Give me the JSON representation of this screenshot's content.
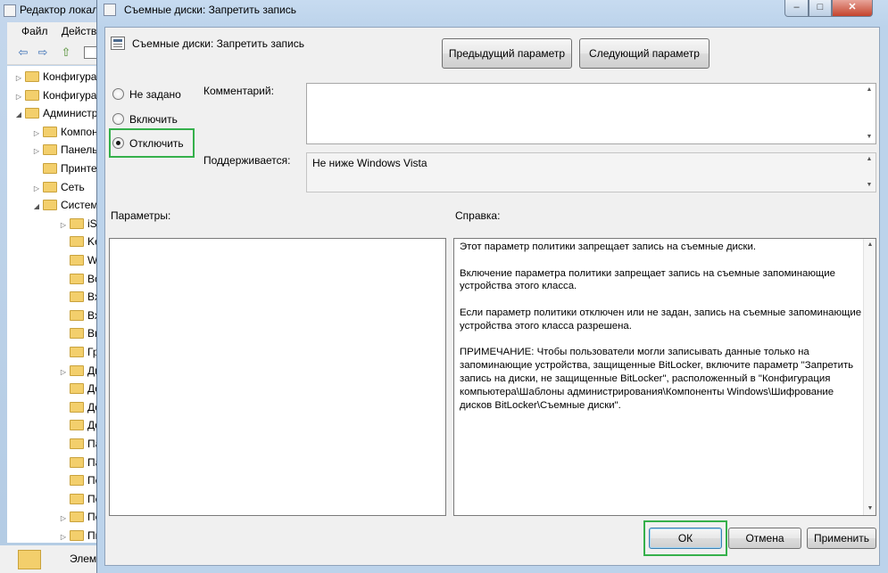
{
  "background_window": {
    "title": "Редактор локальной групповой политики",
    "menu": [
      "Файл",
      "Действие"
    ],
    "tree": [
      {
        "label": "Конфигурация компьютера",
        "indent": 0,
        "arrow": "▷"
      },
      {
        "label": "Конфигурация пользователя",
        "indent": 0,
        "arrow": "▷"
      },
      {
        "label": "Административные шаблоны",
        "indent": 0,
        "arrow": "◢"
      },
      {
        "label": "Компоненты Windows",
        "indent": 1,
        "arrow": "▷"
      },
      {
        "label": "Панель управления",
        "indent": 1,
        "arrow": "▷"
      },
      {
        "label": "Принтеры",
        "indent": 1,
        "arrow": ""
      },
      {
        "label": "Сеть",
        "indent": 1,
        "arrow": "▷"
      },
      {
        "label": "Система",
        "indent": 1,
        "arrow": "◢"
      },
      {
        "label": "iSCSI",
        "indent": 2,
        "arrow": "▷"
      },
      {
        "label": "Kerberos",
        "indent": 2,
        "arrow": ""
      },
      {
        "label": "Windows File Protection",
        "indent": 2,
        "arrow": ""
      },
      {
        "label": "Восстановление",
        "indent": 2,
        "arrow": ""
      },
      {
        "label": "Вход в систему",
        "indent": 2,
        "arrow": ""
      },
      {
        "label": "Входящие",
        "indent": 2,
        "arrow": ""
      },
      {
        "label": "Выключение",
        "indent": 2,
        "arrow": ""
      },
      {
        "label": "Групповая политика",
        "indent": 2,
        "arrow": ""
      },
      {
        "label": "Диагностика",
        "indent": 2,
        "arrow": "▷"
      },
      {
        "label": "Доступ",
        "indent": 2,
        "arrow": ""
      },
      {
        "label": "Доступ к съемным ЗУ",
        "indent": 2,
        "arrow": ""
      },
      {
        "label": "Доступ",
        "indent": 2,
        "arrow": ""
      },
      {
        "label": "Параметры",
        "indent": 2,
        "arrow": ""
      },
      {
        "label": "Параметры",
        "indent": 2,
        "arrow": ""
      },
      {
        "label": "Перенаправление",
        "indent": 2,
        "arrow": ""
      },
      {
        "label": "Перемещаемые профили",
        "indent": 2,
        "arrow": ""
      },
      {
        "label": "Перенос",
        "indent": 2,
        "arrow": "▷"
      },
      {
        "label": "Питание",
        "indent": 2,
        "arrow": "▷"
      }
    ],
    "status_label": "Элементы"
  },
  "dialog": {
    "title": "Съемные диски: Запретить запись",
    "policy_name": "Съемные диски: Запретить запись",
    "caption_buttons": {
      "minimize": "–",
      "maximize": "□",
      "close": "✕"
    },
    "prev_button": "Предыдущий параметр",
    "next_button": "Следующий параметр",
    "radio": {
      "not_configured": "Не задано",
      "enable": "Включить",
      "disable": "Отключить",
      "selected": "disable"
    },
    "comment_label": "Комментарий:",
    "comment_value": "",
    "supported_label": "Поддерживается:",
    "supported_value": "Не ниже Windows Vista",
    "params_label": "Параметры:",
    "help_label": "Справка:",
    "help_text": "Этот параметр политики запрещает запись на съемные диски.\n\nВключение параметра политики запрещает запись на съемные запоминающие устройства этого класса.\n\nЕсли параметр политики отключен или не задан, запись на съемные запоминающие устройства этого класса разрешена.\n\nПРИМЕЧАНИЕ: Чтобы пользователи могли записывать данные только на запоминающие устройства, защищенные BitLocker, включите параметр \"Запретить запись на диски, не защищенные BitLocker\", расположенный в \"Конфигурация компьютера\\Шаблоны администрирования\\Компоненты Windows\\Шифрование дисков BitLocker\\Съемные диски\".",
    "ok_button": "ОК",
    "cancel_button": "Отмена",
    "apply_button": "Применить",
    "scroll_up_glyph": "▲",
    "scroll_down_glyph": "▼",
    "highlight_color": "#35b04b"
  }
}
